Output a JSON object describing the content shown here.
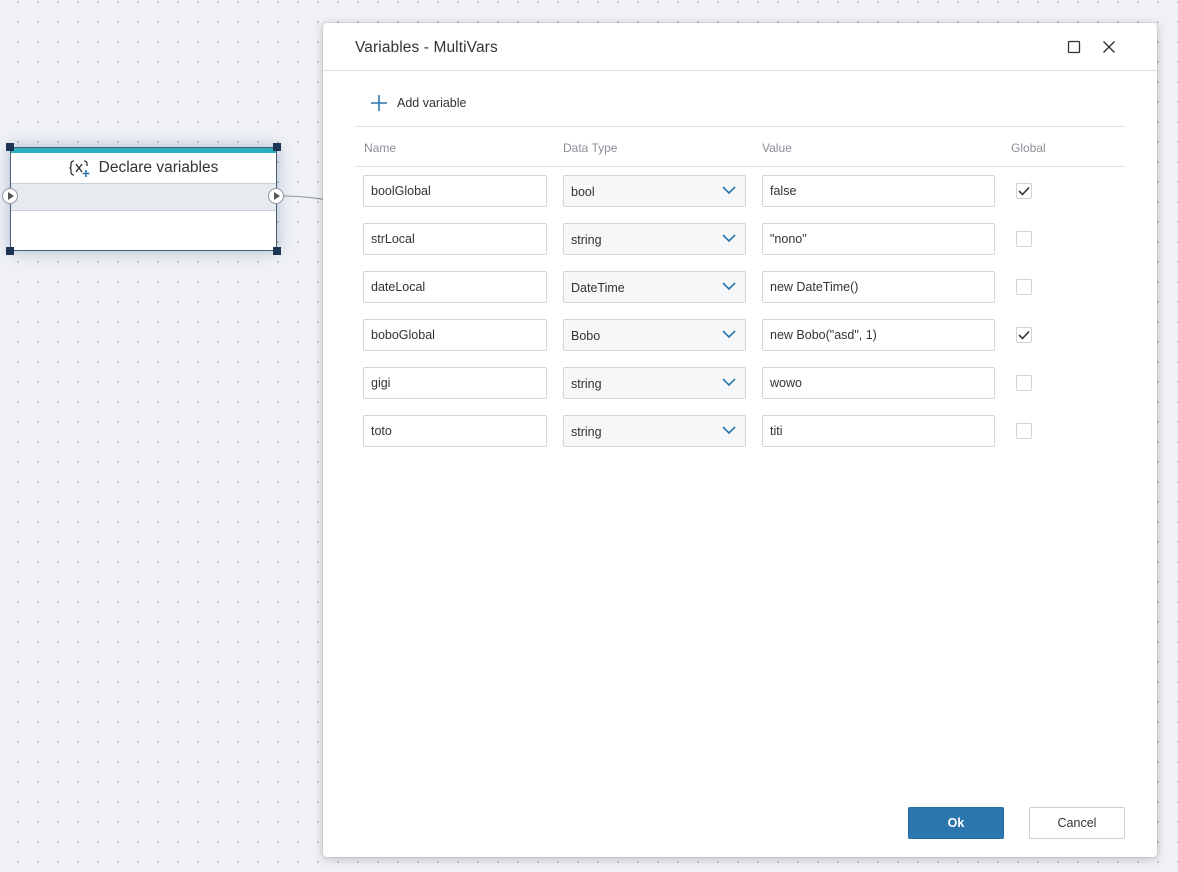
{
  "node": {
    "title": "Declare variables",
    "icon": "declare-variables-icon"
  },
  "dialog": {
    "title": "Variables - MultiVars",
    "add_label": "Add variable",
    "columns": {
      "name": "Name",
      "type": "Data Type",
      "value": "Value",
      "global": "Global"
    },
    "rows": [
      {
        "name": "boolGlobal",
        "type": "bool",
        "value": "false",
        "global": true
      },
      {
        "name": "strLocal",
        "type": "string",
        "value": "\"nono\"",
        "global": false
      },
      {
        "name": "dateLocal",
        "type": "DateTime",
        "value": "new DateTime()",
        "global": false
      },
      {
        "name": "boboGlobal",
        "type": "Bobo",
        "value": "new Bobo(\"asd\", 1)",
        "global": true
      },
      {
        "name": "gigi",
        "type": "string",
        "value": "wowo",
        "global": false
      },
      {
        "name": "toto",
        "type": "string",
        "value": "titi",
        "global": false
      }
    ],
    "ok_label": "Ok",
    "cancel_label": "Cancel"
  },
  "colors": {
    "accent": "#2b77ad",
    "node_top_bar": "#2bb0c1",
    "canvas_bg": "#eff1f4"
  }
}
